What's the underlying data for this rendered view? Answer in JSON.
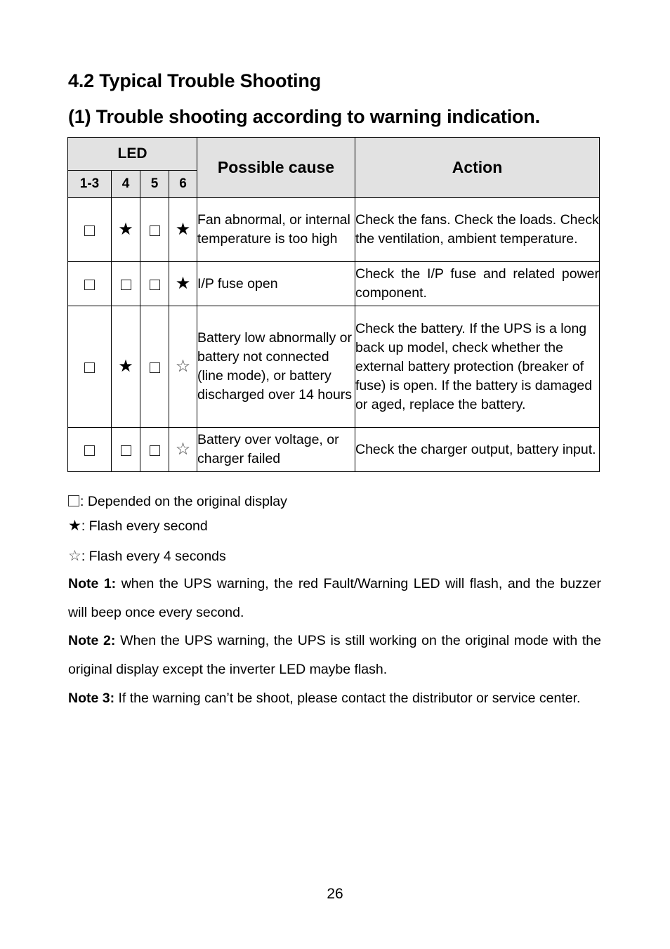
{
  "section_title": "4.2 Typical Trouble Shooting",
  "subsection_title": "(1) Trouble shooting according to warning indication.",
  "table": {
    "headers": {
      "led": "LED",
      "cause": "Possible cause",
      "action": "Action",
      "led_columns": [
        "1-3",
        "4",
        "5",
        "6"
      ]
    },
    "rows": [
      {
        "led": [
          "box",
          "star-filled",
          "box",
          "star-filled"
        ],
        "cause": "Fan abnormal, or internal temperature is too high",
        "action": "Check the fans. Check the loads. Check the ventilation, ambient temperature."
      },
      {
        "led": [
          "box",
          "box",
          "box",
          "star-filled"
        ],
        "cause": "I/P fuse open",
        "action": "Check the I/P fuse and related power component."
      },
      {
        "led": [
          "box",
          "star-filled",
          "box",
          "star-outline"
        ],
        "cause": "Battery low abnormally or battery not connected (line mode), or battery discharged over 14 hours",
        "action": "Check the battery. If the UPS is a long back up model, check whether the external battery protection (breaker of fuse) is open. If the battery is damaged or aged, replace the battery."
      },
      {
        "led": [
          "box",
          "box",
          "box",
          "star-outline"
        ],
        "cause": "Battery over voltage, or charger failed",
        "action": "Check the charger output, battery input."
      }
    ]
  },
  "legend": [
    {
      "symbol": "box",
      "text": ": Depended on the original display"
    },
    {
      "symbol": "star-filled",
      "text": ": Flash every second"
    },
    {
      "symbol": "star-outline",
      "text": ": Flash every 4 seconds"
    }
  ],
  "notes": [
    {
      "label": "Note 1:",
      "text": " when the UPS warning, the red Fault/Warning LED will flash, and the buzzer will beep once every second."
    },
    {
      "label": "Note 2:",
      "text": " When the UPS warning, the UPS is still working on the original mode with the original display except the inverter LED maybe flash."
    },
    {
      "label": "Note 3:",
      "text": " If the warning can’t be shoot, please contact the distributor or service center."
    }
  ],
  "page_number": "26"
}
